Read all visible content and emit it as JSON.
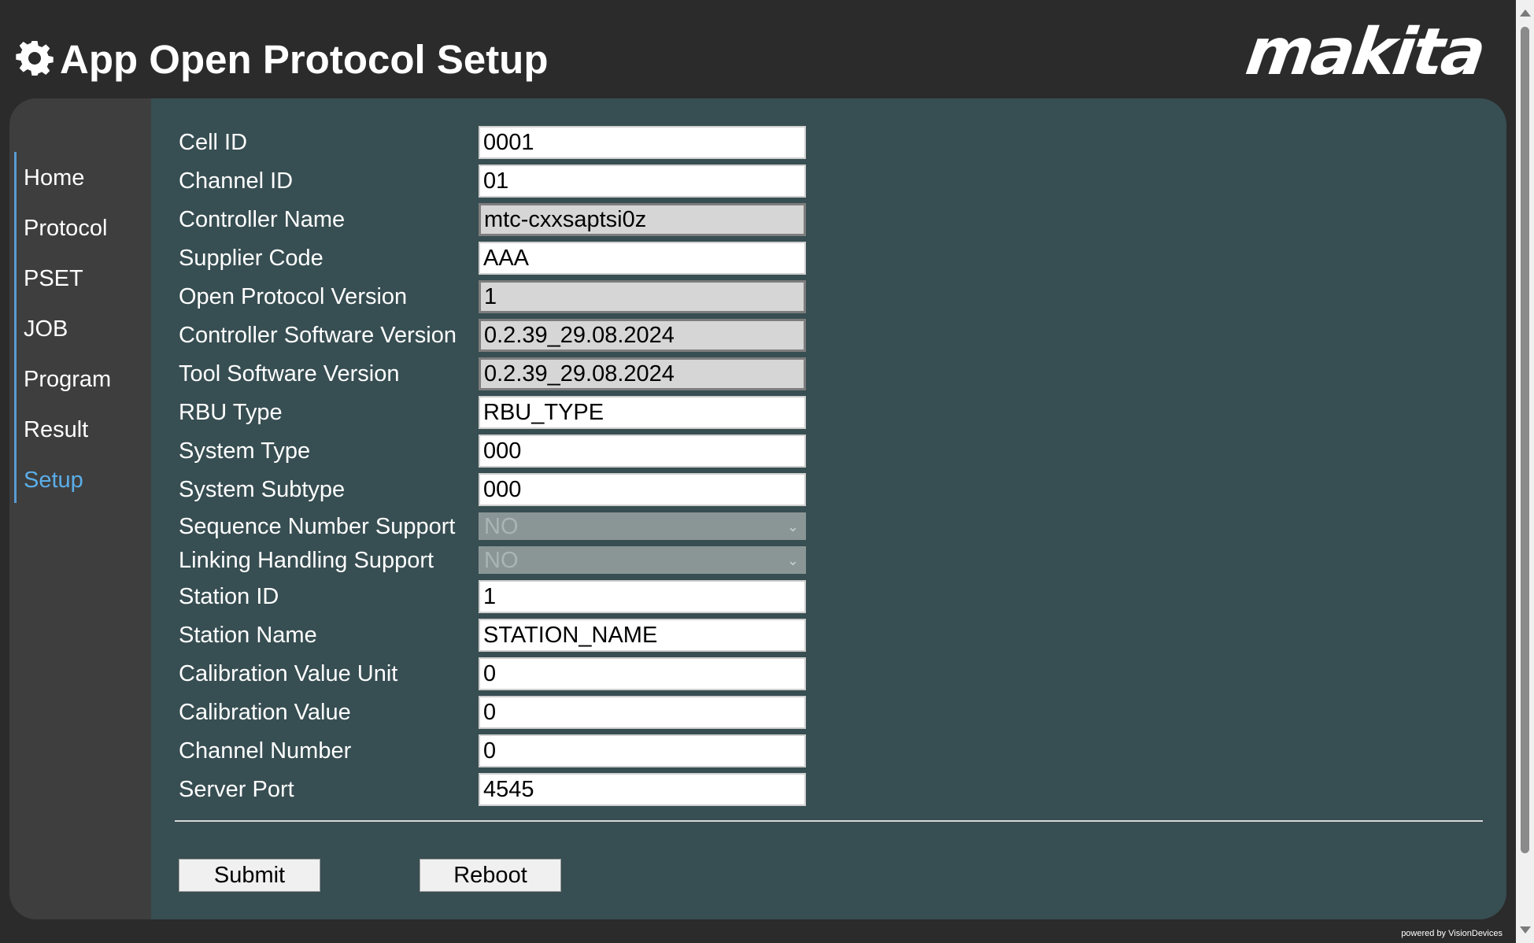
{
  "header": {
    "title": "App Open Protocol Setup",
    "settings_icon": "gear-icon",
    "logo_text": "makita"
  },
  "nav": {
    "items": [
      {
        "label": "Home"
      },
      {
        "label": "Protocol"
      },
      {
        "label": "PSET"
      },
      {
        "label": "JOB"
      },
      {
        "label": "Program"
      },
      {
        "label": "Result"
      },
      {
        "label": "Setup"
      }
    ],
    "active": "Setup",
    "active_color": "#5aaee8"
  },
  "form": {
    "cell_id": {
      "label": "Cell ID",
      "value": "0001"
    },
    "channel_id": {
      "label": "Channel ID",
      "value": "01"
    },
    "controller_name": {
      "label": "Controller Name",
      "value": "mtc-cxxsaptsi0z"
    },
    "supplier_code": {
      "label": "Supplier Code",
      "value": "AAA"
    },
    "open_protocol_version": {
      "label": "Open Protocol Version",
      "value": "1"
    },
    "controller_software_version": {
      "label": "Controller Software Version",
      "value": "0.2.39_29.08.2024"
    },
    "tool_software_version": {
      "label": "Tool Software Version",
      "value": "0.2.39_29.08.2024"
    },
    "rbu_type": {
      "label": "RBU Type",
      "value": "RBU_TYPE"
    },
    "system_type": {
      "label": "System Type",
      "value": "000"
    },
    "system_subtype": {
      "label": "System Subtype",
      "value": "000"
    },
    "sequence_number_support": {
      "label": "Sequence Number Support",
      "value": "NO"
    },
    "linking_handling_support": {
      "label": "Linking Handling Support",
      "value": "NO"
    },
    "station_id": {
      "label": "Station ID",
      "value": "1"
    },
    "station_name": {
      "label": "Station Name",
      "value": "STATION_NAME"
    },
    "calibration_value_unit": {
      "label": "Calibration Value Unit",
      "value": "0"
    },
    "calibration_value": {
      "label": "Calibration Value",
      "value": "0"
    },
    "channel_number": {
      "label": "Channel Number",
      "value": "0"
    },
    "server_port": {
      "label": "Server Port",
      "value": "4545"
    }
  },
  "actions": {
    "submit_label": "Submit",
    "reboot_label": "Reboot"
  },
  "footer": {
    "powered_by": "powered by VisionDevices"
  },
  "colors": {
    "header_bg": "#2b2b2b",
    "sidebar_bg": "#3e3e3e",
    "content_bg": "#374e52",
    "accent": "#5a9bd4"
  }
}
